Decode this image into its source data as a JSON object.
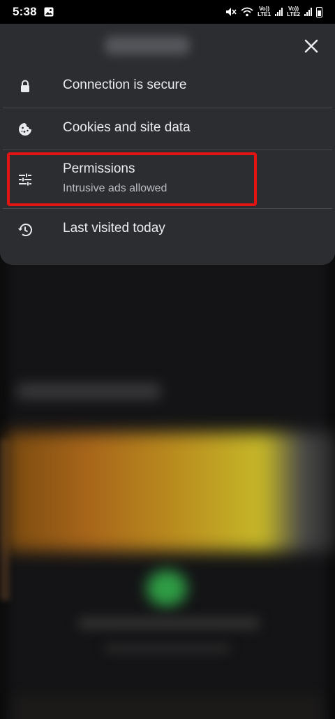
{
  "status_bar": {
    "time": "5:38",
    "sim1_label": "Vo)) LTE1",
    "sim2_label": "Vo)) LTE2",
    "sim1_top": "Vo))",
    "sim1_bottom": "LTE1",
    "sim2_top": "Vo))",
    "sim2_bottom": "LTE2"
  },
  "panel": {
    "site_name": "",
    "items": [
      {
        "icon": "lock-icon",
        "title": "Connection is secure"
      },
      {
        "icon": "cookie-icon",
        "title": "Cookies and site data"
      },
      {
        "icon": "tune-icon",
        "title": "Permissions",
        "subtitle": "Intrusive ads allowed"
      },
      {
        "icon": "history-icon",
        "title": "Last visited today"
      }
    ]
  },
  "colors": {
    "panel_bg": "#2c2d31",
    "highlight": "#e11414",
    "text_primary": "#ececef",
    "text_secondary": "#b9bcc2"
  }
}
